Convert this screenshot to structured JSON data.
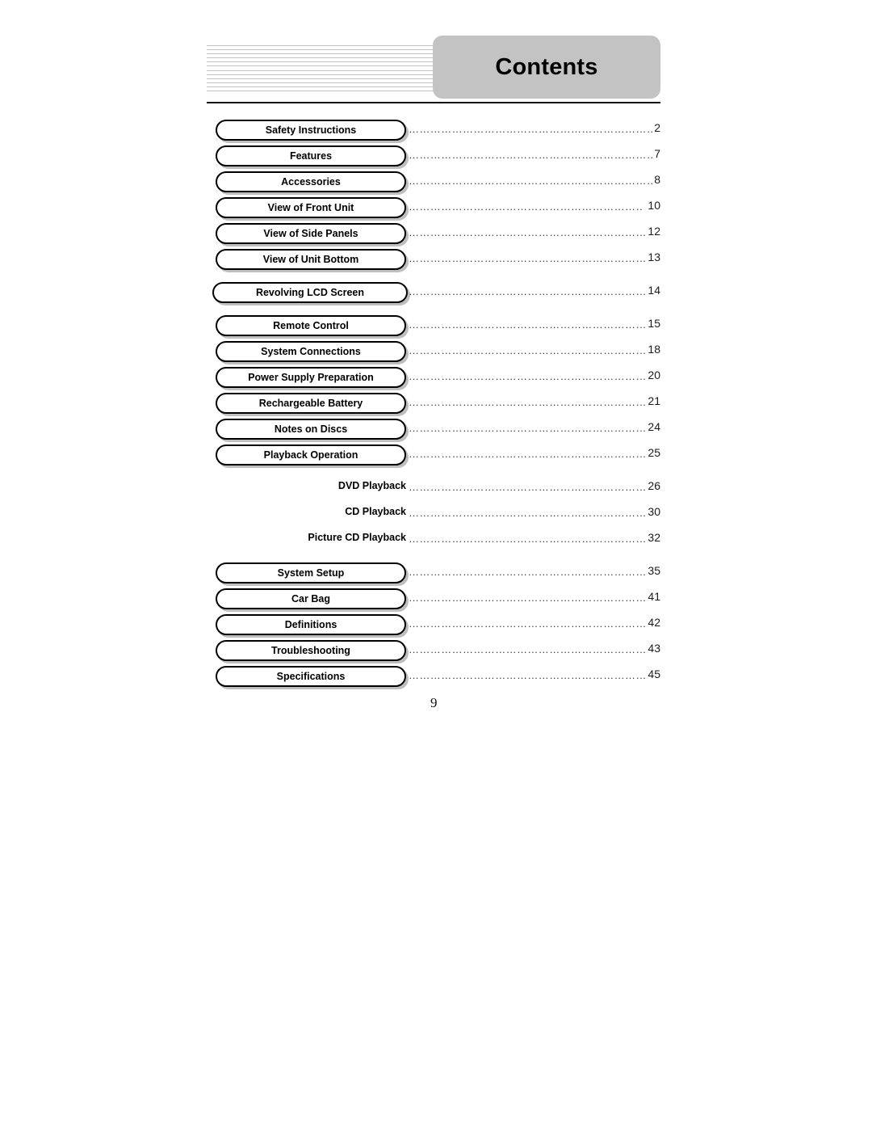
{
  "header": {
    "title": "Contents",
    "badge_color": "#c3c3c3",
    "rule_color": "#111111",
    "decorative_line_count": 12
  },
  "toc": {
    "entries": [
      {
        "label": "Safety Instructions",
        "page": "2",
        "type": "boxed",
        "gap_before": false,
        "wide": false
      },
      {
        "label": "Features",
        "page": "7",
        "type": "boxed",
        "gap_before": false,
        "wide": false
      },
      {
        "label": "Accessories",
        "page": "8",
        "type": "boxed",
        "gap_before": false,
        "wide": false
      },
      {
        "label": "View of Front Unit",
        "page": "10",
        "type": "boxed",
        "gap_before": false,
        "wide": false
      },
      {
        "label": "View of Side Panels",
        "page": "12",
        "type": "boxed",
        "gap_before": false,
        "wide": false
      },
      {
        "label": "View of Unit Bottom",
        "page": "13",
        "type": "boxed",
        "gap_before": false,
        "wide": false
      },
      {
        "label": "Revolving LCD Screen",
        "page": "14",
        "type": "boxed",
        "gap_before": true,
        "wide": true
      },
      {
        "label": "Remote Control",
        "page": "15",
        "type": "boxed",
        "gap_before": true,
        "wide": false
      },
      {
        "label": "System Connections",
        "page": "18",
        "type": "boxed",
        "gap_before": false,
        "wide": false
      },
      {
        "label": "Power Supply Preparation",
        "page": "20",
        "type": "boxed",
        "gap_before": false,
        "wide": false
      },
      {
        "label": "Rechargeable Battery",
        "page": "21",
        "type": "boxed",
        "gap_before": false,
        "wide": false
      },
      {
        "label": "Notes on Discs",
        "page": "24",
        "type": "boxed",
        "gap_before": false,
        "wide": false
      },
      {
        "label": "Playback Operation",
        "page": "25",
        "type": "boxed",
        "gap_before": false,
        "wide": false
      },
      {
        "label": "DVD Playback",
        "page": "26",
        "type": "plain",
        "gap_before": true,
        "wide": false
      },
      {
        "label": "CD Playback",
        "page": "30",
        "type": "plain",
        "gap_before": false,
        "wide": false
      },
      {
        "label": "Picture CD Playback",
        "page": "32",
        "type": "plain",
        "gap_before": false,
        "wide": false
      },
      {
        "label": "System Setup",
        "page": "35",
        "type": "boxed",
        "gap_before": true,
        "wide": false
      },
      {
        "label": "Car Bag",
        "page": "41",
        "type": "boxed",
        "gap_before": false,
        "wide": false
      },
      {
        "label": "Definitions",
        "page": "42",
        "type": "boxed",
        "gap_before": false,
        "wide": false
      },
      {
        "label": "Troubleshooting",
        "page": "43",
        "type": "boxed",
        "gap_before": false,
        "wide": false
      },
      {
        "label": "Specifications",
        "page": "45",
        "type": "boxed",
        "gap_before": false,
        "wide": false
      }
    ],
    "leader": "……………………………………………………………………………………"
  },
  "folio": {
    "page_number": "9"
  }
}
